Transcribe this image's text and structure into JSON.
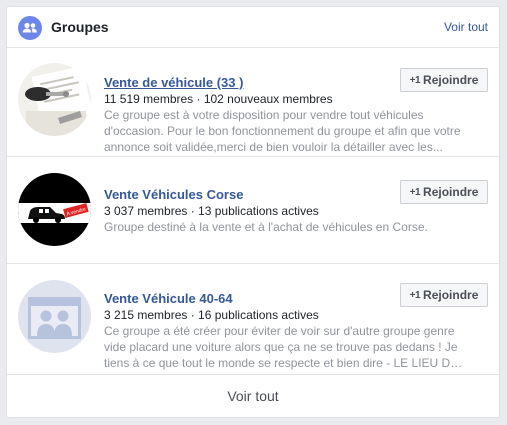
{
  "header": {
    "title": "Groupes",
    "see_all": "Voir tout",
    "icon": "groups-icon"
  },
  "groups": [
    {
      "name": "Vente de véhicule (33 )",
      "stats": "11 519 membres · 102 nouveaux membres",
      "description": "Ce groupe est à votre disposition pour vendre tout véhicules d'occasion. Pour le bon fonctionnement du groupe et afin que votre annonce soit validée,merci de bien vouloir la détailler avec les...",
      "join_label": "Rejoindre",
      "join_prefix": "+1"
    },
    {
      "name": "Vente Véhicules Corse",
      "stats": "3 037 membres · 13 publications actives",
      "description": "Groupe destiné à la vente et à l'achat de véhicules en Corse.",
      "join_label": "Rejoindre",
      "join_prefix": "+1",
      "sign_text": "A vendre"
    },
    {
      "name": "Vente Véhicule 40-64",
      "stats": "3 215 membres · 16 publications actives",
      "description": "Ce groupe a été créer pour éviter de voir sur d'autre groupe genre vide placard une voiture alors que ça ne se trouve pas dedans ! Je tiens à ce que tout le monde se respecte et bien dire - LE LIEU DU VÉHICU...",
      "join_label": "Rejoindre",
      "join_prefix": "+1"
    }
  ],
  "footer": {
    "see_all": "Voir tout"
  },
  "colors": {
    "link": "#365899",
    "accent": "#6d86ec",
    "muted": "#90949c"
  }
}
